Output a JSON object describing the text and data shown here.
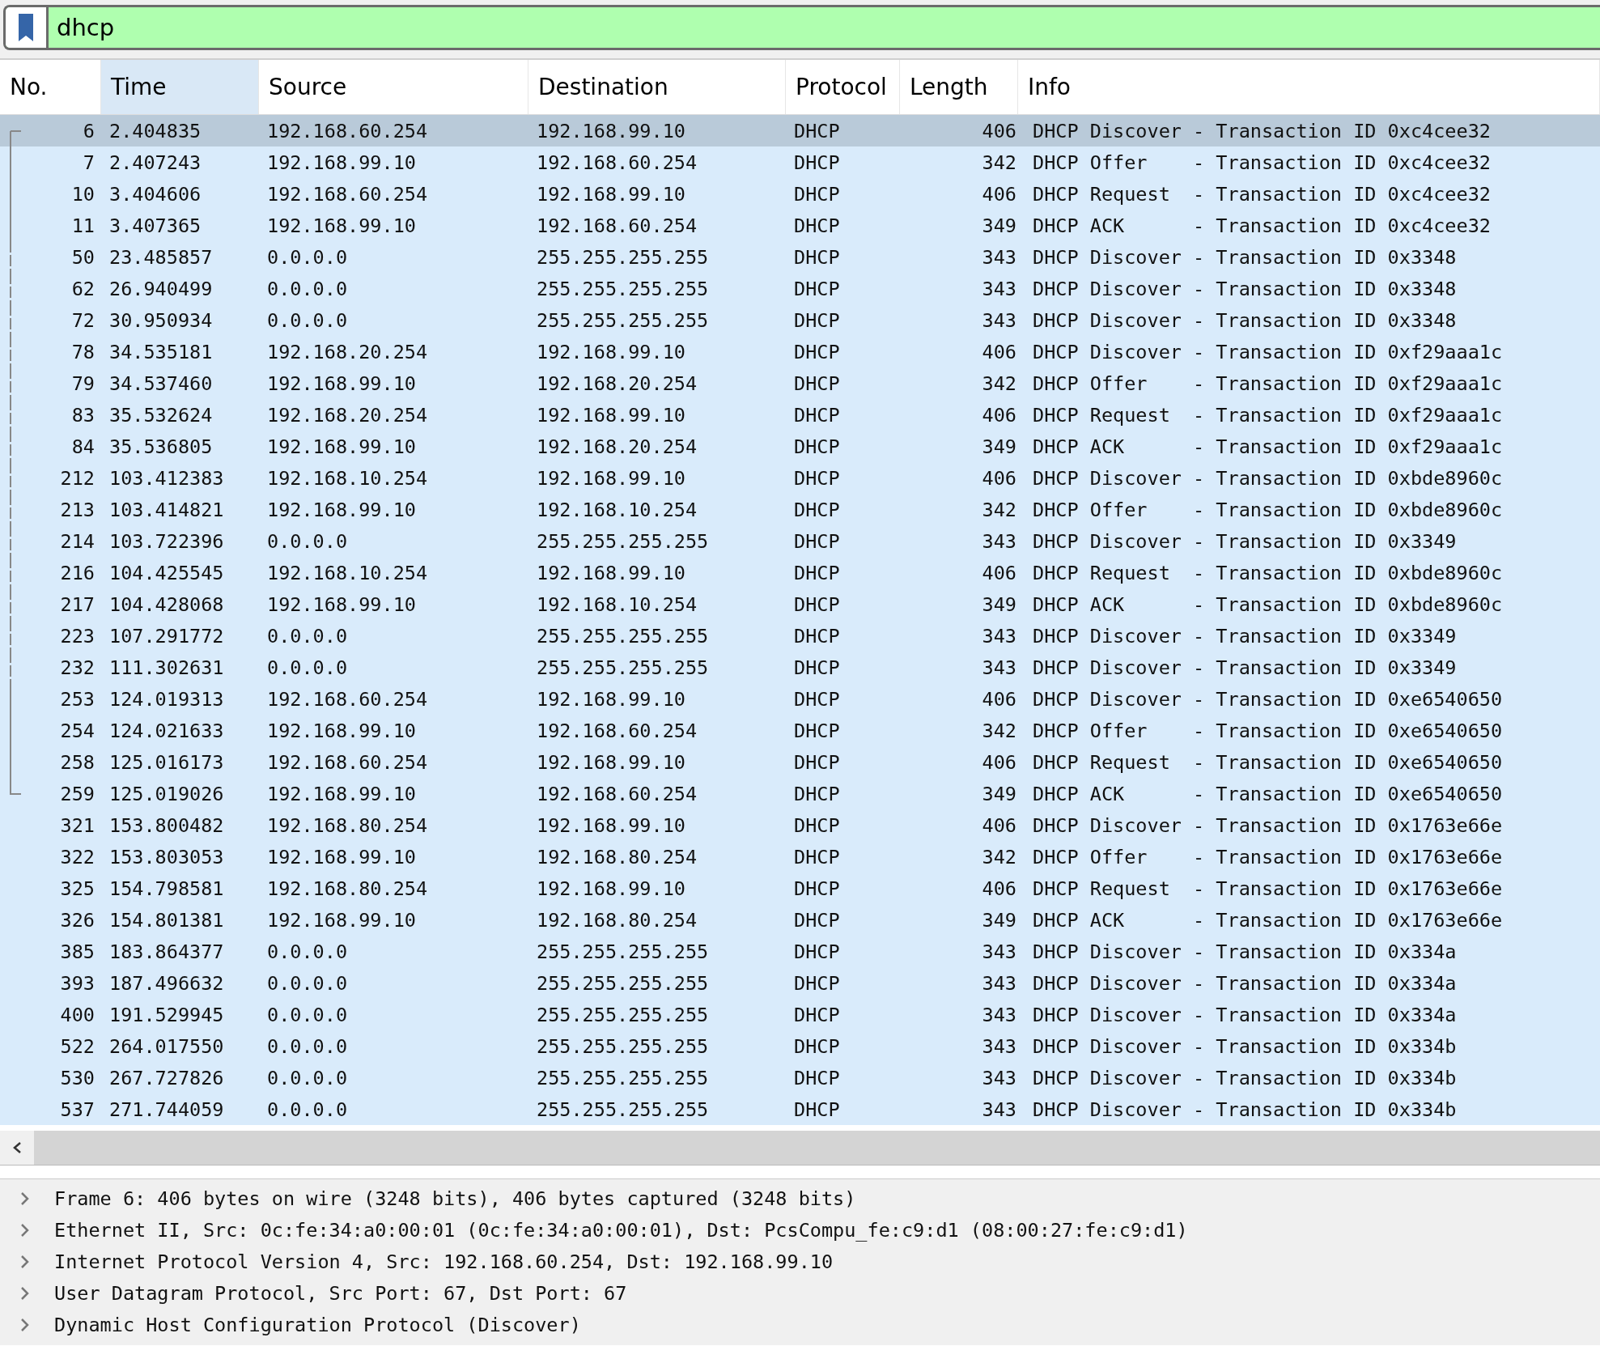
{
  "filter": {
    "value": "dhcp"
  },
  "table": {
    "columns": [
      {
        "label": "No.",
        "sorted": false
      },
      {
        "label": "Time",
        "sorted": true
      },
      {
        "label": "Source",
        "sorted": false
      },
      {
        "label": "Destination",
        "sorted": false
      },
      {
        "label": "Protocol",
        "sorted": false
      },
      {
        "label": "Length",
        "sorted": false
      },
      {
        "label": "Info",
        "sorted": false
      }
    ],
    "rows": [
      {
        "no": "6",
        "time": "2.404835",
        "source": "192.168.60.254",
        "destination": "192.168.99.10",
        "protocol": "DHCP",
        "length": "406",
        "info": "DHCP Discover - Transaction ID 0xc4cee32",
        "selected": true,
        "kind": "start"
      },
      {
        "no": "7",
        "time": "2.407243",
        "source": "192.168.99.10",
        "destination": "192.168.60.254",
        "protocol": "DHCP",
        "length": "342",
        "info": "DHCP Offer    - Transaction ID 0xc4cee32",
        "selected": false,
        "kind": "solid"
      },
      {
        "no": "10",
        "time": "3.404606",
        "source": "192.168.60.254",
        "destination": "192.168.99.10",
        "protocol": "DHCP",
        "length": "406",
        "info": "DHCP Request  - Transaction ID 0xc4cee32",
        "selected": false,
        "kind": "solid"
      },
      {
        "no": "11",
        "time": "3.407365",
        "source": "192.168.99.10",
        "destination": "192.168.60.254",
        "protocol": "DHCP",
        "length": "349",
        "info": "DHCP ACK      - Transaction ID 0xc4cee32",
        "selected": false,
        "kind": "solid"
      },
      {
        "no": "50",
        "time": "23.485857",
        "source": "0.0.0.0",
        "destination": "255.255.255.255",
        "protocol": "DHCP",
        "length": "343",
        "info": "DHCP Discover - Transaction ID 0x3348",
        "selected": false,
        "kind": "dashed"
      },
      {
        "no": "62",
        "time": "26.940499",
        "source": "0.0.0.0",
        "destination": "255.255.255.255",
        "protocol": "DHCP",
        "length": "343",
        "info": "DHCP Discover - Transaction ID 0x3348",
        "selected": false,
        "kind": "dashed"
      },
      {
        "no": "72",
        "time": "30.950934",
        "source": "0.0.0.0",
        "destination": "255.255.255.255",
        "protocol": "DHCP",
        "length": "343",
        "info": "DHCP Discover - Transaction ID 0x3348",
        "selected": false,
        "kind": "dashed"
      },
      {
        "no": "78",
        "time": "34.535181",
        "source": "192.168.20.254",
        "destination": "192.168.99.10",
        "protocol": "DHCP",
        "length": "406",
        "info": "DHCP Discover - Transaction ID 0xf29aaa1c",
        "selected": false,
        "kind": "dashed"
      },
      {
        "no": "79",
        "time": "34.537460",
        "source": "192.168.99.10",
        "destination": "192.168.20.254",
        "protocol": "DHCP",
        "length": "342",
        "info": "DHCP Offer    - Transaction ID 0xf29aaa1c",
        "selected": false,
        "kind": "dashed"
      },
      {
        "no": "83",
        "time": "35.532624",
        "source": "192.168.20.254",
        "destination": "192.168.99.10",
        "protocol": "DHCP",
        "length": "406",
        "info": "DHCP Request  - Transaction ID 0xf29aaa1c",
        "selected": false,
        "kind": "dashed"
      },
      {
        "no": "84",
        "time": "35.536805",
        "source": "192.168.99.10",
        "destination": "192.168.20.254",
        "protocol": "DHCP",
        "length": "349",
        "info": "DHCP ACK      - Transaction ID 0xf29aaa1c",
        "selected": false,
        "kind": "dashed"
      },
      {
        "no": "212",
        "time": "103.412383",
        "source": "192.168.10.254",
        "destination": "192.168.99.10",
        "protocol": "DHCP",
        "length": "406",
        "info": "DHCP Discover - Transaction ID 0xbde8960c",
        "selected": false,
        "kind": "dashed"
      },
      {
        "no": "213",
        "time": "103.414821",
        "source": "192.168.99.10",
        "destination": "192.168.10.254",
        "protocol": "DHCP",
        "length": "342",
        "info": "DHCP Offer    - Transaction ID 0xbde8960c",
        "selected": false,
        "kind": "dashed"
      },
      {
        "no": "214",
        "time": "103.722396",
        "source": "0.0.0.0",
        "destination": "255.255.255.255",
        "protocol": "DHCP",
        "length": "343",
        "info": "DHCP Discover - Transaction ID 0x3349",
        "selected": false,
        "kind": "dashed"
      },
      {
        "no": "216",
        "time": "104.425545",
        "source": "192.168.10.254",
        "destination": "192.168.99.10",
        "protocol": "DHCP",
        "length": "406",
        "info": "DHCP Request  - Transaction ID 0xbde8960c",
        "selected": false,
        "kind": "dashed"
      },
      {
        "no": "217",
        "time": "104.428068",
        "source": "192.168.99.10",
        "destination": "192.168.10.254",
        "protocol": "DHCP",
        "length": "349",
        "info": "DHCP ACK      - Transaction ID 0xbde8960c",
        "selected": false,
        "kind": "dashed"
      },
      {
        "no": "223",
        "time": "107.291772",
        "source": "0.0.0.0",
        "destination": "255.255.255.255",
        "protocol": "DHCP",
        "length": "343",
        "info": "DHCP Discover - Transaction ID 0x3349",
        "selected": false,
        "kind": "dashed"
      },
      {
        "no": "232",
        "time": "111.302631",
        "source": "0.0.0.0",
        "destination": "255.255.255.255",
        "protocol": "DHCP",
        "length": "343",
        "info": "DHCP Discover - Transaction ID 0x3349",
        "selected": false,
        "kind": "dashed"
      },
      {
        "no": "253",
        "time": "124.019313",
        "source": "192.168.60.254",
        "destination": "192.168.99.10",
        "protocol": "DHCP",
        "length": "406",
        "info": "DHCP Discover - Transaction ID 0xe6540650",
        "selected": false,
        "kind": "solid"
      },
      {
        "no": "254",
        "time": "124.021633",
        "source": "192.168.99.10",
        "destination": "192.168.60.254",
        "protocol": "DHCP",
        "length": "342",
        "info": "DHCP Offer    - Transaction ID 0xe6540650",
        "selected": false,
        "kind": "solid"
      },
      {
        "no": "258",
        "time": "125.016173",
        "source": "192.168.60.254",
        "destination": "192.168.99.10",
        "protocol": "DHCP",
        "length": "406",
        "info": "DHCP Request  - Transaction ID 0xe6540650",
        "selected": false,
        "kind": "solid"
      },
      {
        "no": "259",
        "time": "125.019026",
        "source": "192.168.99.10",
        "destination": "192.168.60.254",
        "protocol": "DHCP",
        "length": "349",
        "info": "DHCP ACK      - Transaction ID 0xe6540650",
        "selected": false,
        "kind": "end"
      },
      {
        "no": "321",
        "time": "153.800482",
        "source": "192.168.80.254",
        "destination": "192.168.99.10",
        "protocol": "DHCP",
        "length": "406",
        "info": "DHCP Discover - Transaction ID 0x1763e66e",
        "selected": false,
        "kind": "plain"
      },
      {
        "no": "322",
        "time": "153.803053",
        "source": "192.168.99.10",
        "destination": "192.168.80.254",
        "protocol": "DHCP",
        "length": "342",
        "info": "DHCP Offer    - Transaction ID 0x1763e66e",
        "selected": false,
        "kind": "plain"
      },
      {
        "no": "325",
        "time": "154.798581",
        "source": "192.168.80.254",
        "destination": "192.168.99.10",
        "protocol": "DHCP",
        "length": "406",
        "info": "DHCP Request  - Transaction ID 0x1763e66e",
        "selected": false,
        "kind": "plain"
      },
      {
        "no": "326",
        "time": "154.801381",
        "source": "192.168.99.10",
        "destination": "192.168.80.254",
        "protocol": "DHCP",
        "length": "349",
        "info": "DHCP ACK      - Transaction ID 0x1763e66e",
        "selected": false,
        "kind": "plain"
      },
      {
        "no": "385",
        "time": "183.864377",
        "source": "0.0.0.0",
        "destination": "255.255.255.255",
        "protocol": "DHCP",
        "length": "343",
        "info": "DHCP Discover - Transaction ID 0x334a",
        "selected": false,
        "kind": "plain"
      },
      {
        "no": "393",
        "time": "187.496632",
        "source": "0.0.0.0",
        "destination": "255.255.255.255",
        "protocol": "DHCP",
        "length": "343",
        "info": "DHCP Discover - Transaction ID 0x334a",
        "selected": false,
        "kind": "plain"
      },
      {
        "no": "400",
        "time": "191.529945",
        "source": "0.0.0.0",
        "destination": "255.255.255.255",
        "protocol": "DHCP",
        "length": "343",
        "info": "DHCP Discover - Transaction ID 0x334a",
        "selected": false,
        "kind": "plain"
      },
      {
        "no": "522",
        "time": "264.017550",
        "source": "0.0.0.0",
        "destination": "255.255.255.255",
        "protocol": "DHCP",
        "length": "343",
        "info": "DHCP Discover - Transaction ID 0x334b",
        "selected": false,
        "kind": "plain"
      },
      {
        "no": "530",
        "time": "267.727826",
        "source": "0.0.0.0",
        "destination": "255.255.255.255",
        "protocol": "DHCP",
        "length": "343",
        "info": "DHCP Discover - Transaction ID 0x334b",
        "selected": false,
        "kind": "plain"
      },
      {
        "no": "537",
        "time": "271.744059",
        "source": "0.0.0.0",
        "destination": "255.255.255.255",
        "protocol": "DHCP",
        "length": "343",
        "info": "DHCP Discover - Transaction ID 0x334b",
        "selected": false,
        "kind": "plain"
      }
    ]
  },
  "details": [
    {
      "text": "Frame 6: 406 bytes on wire (3248 bits), 406 bytes captured (3248 bits)",
      "expanded": false
    },
    {
      "text": "Ethernet II, Src: 0c:fe:34:a0:00:01 (0c:fe:34:a0:00:01), Dst: PcsCompu_fe:c9:d1 (08:00:27:fe:c9:d1)",
      "expanded": false
    },
    {
      "text": "Internet Protocol Version 4, Src: 192.168.60.254, Dst: 192.168.99.10",
      "expanded": false
    },
    {
      "text": "User Datagram Protocol, Src Port: 67, Dst Port: 67",
      "expanded": false
    },
    {
      "text": "Dynamic Host Configuration Protocol (Discover)",
      "expanded": false
    }
  ]
}
